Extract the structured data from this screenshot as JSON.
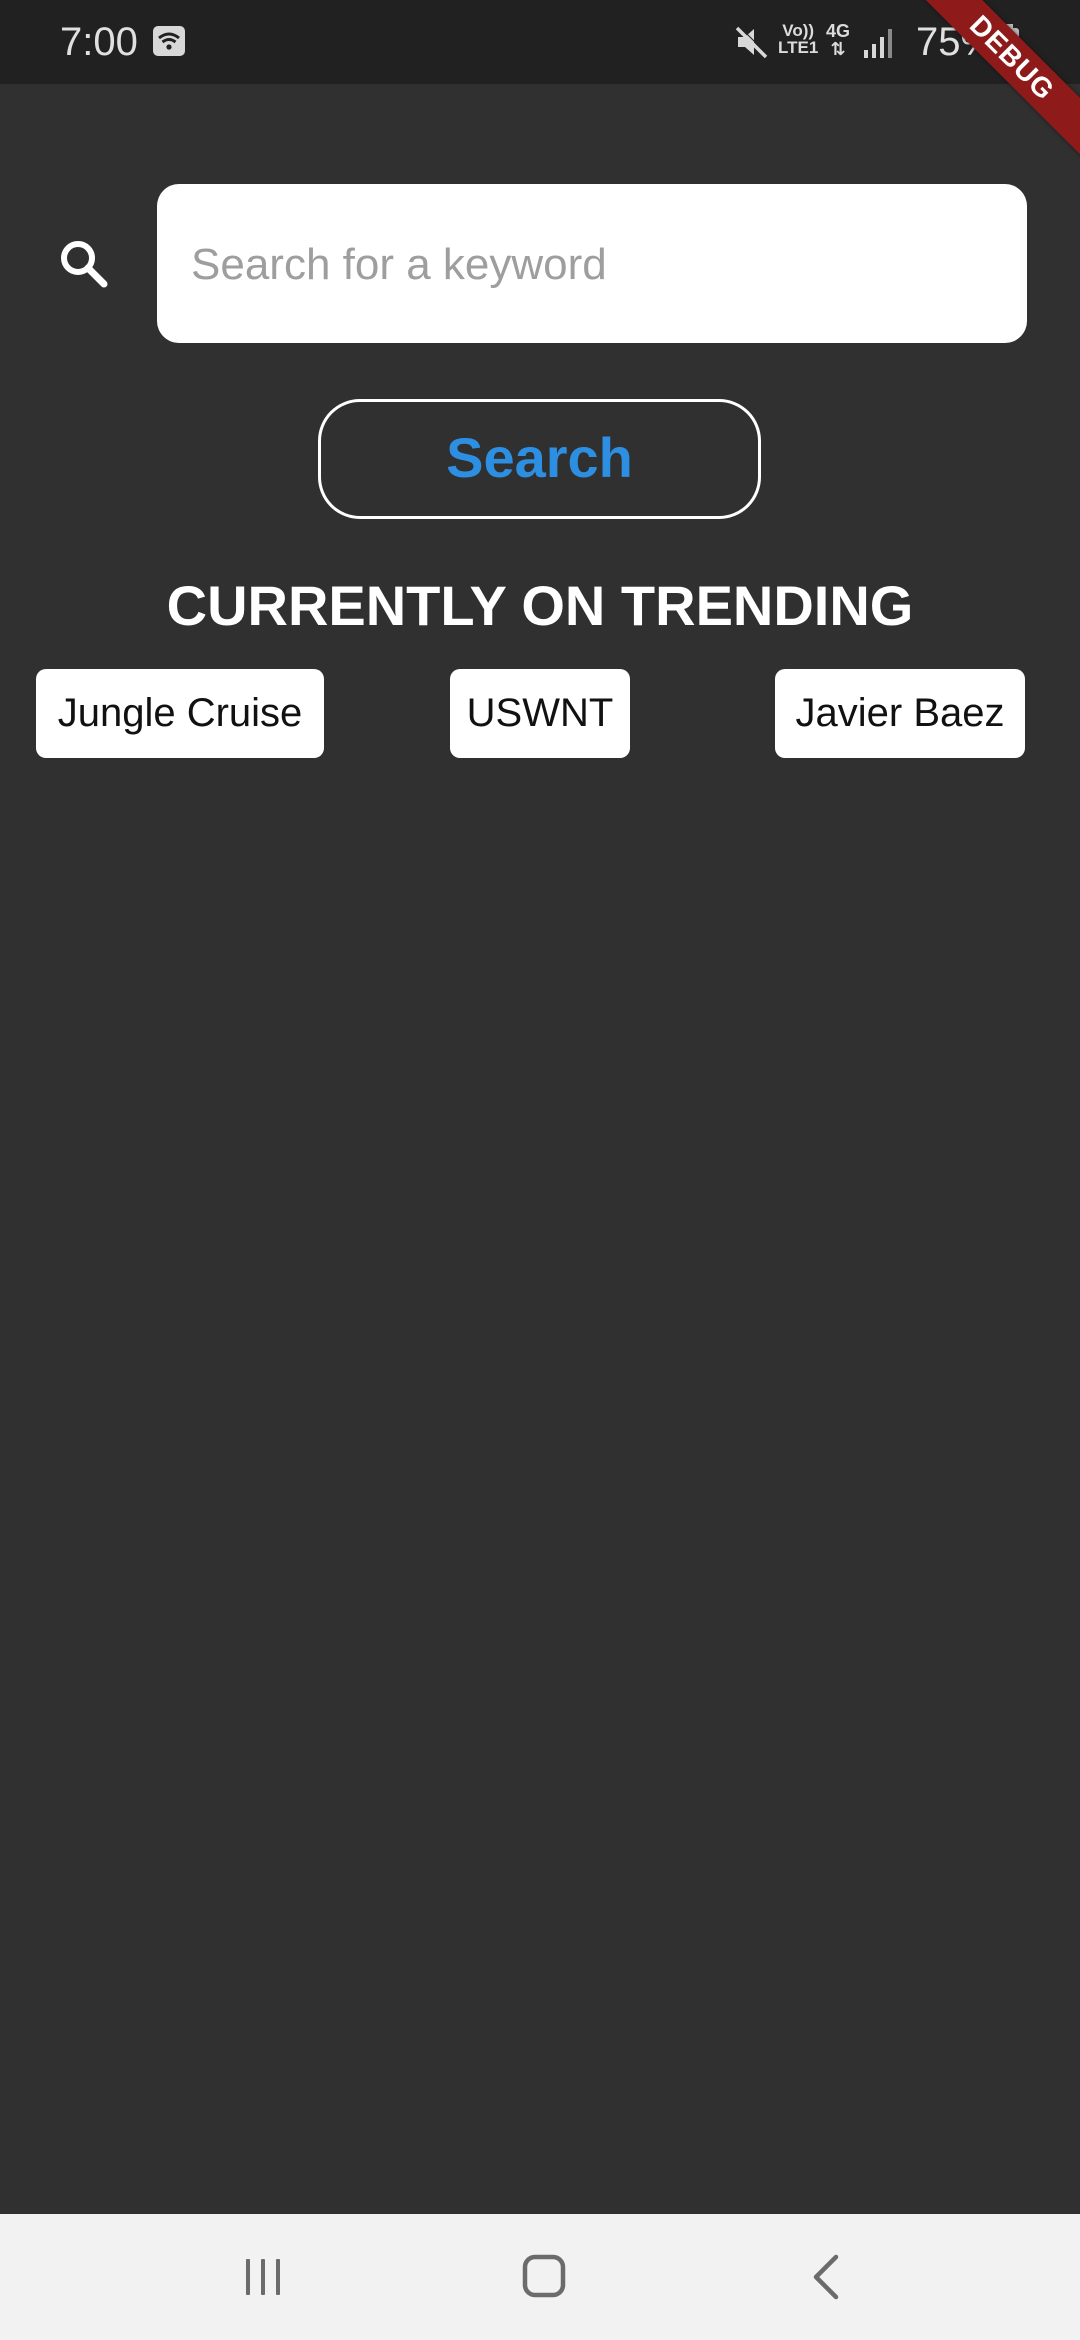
{
  "status_bar": {
    "time": "7:00",
    "volte_line1": "Vo))",
    "volte_line2": "LTE1",
    "network": "4G",
    "battery_percent": "75%",
    "icons": [
      "wifi-icon",
      "mute-icon",
      "signal-icon",
      "battery-icon"
    ]
  },
  "debug_banner": "DEBUG",
  "search": {
    "placeholder": "Search for a keyword",
    "value": "",
    "button_label": "Search",
    "icon": "search-icon"
  },
  "trending": {
    "title": "CURRENTLY ON TRENDING",
    "items": [
      {
        "label": "Jungle Cruise"
      },
      {
        "label": "USWNT"
      },
      {
        "label": "Javier Baez"
      }
    ]
  },
  "nav_bar": {
    "icons": [
      "recent-apps-icon",
      "home-icon",
      "back-icon"
    ]
  },
  "colors": {
    "background": "#303030",
    "status_bar": "#212121",
    "accent": "#2d8fe2",
    "debug_banner": "#8e1a1a",
    "nav_bar": "#f2f2f2"
  }
}
